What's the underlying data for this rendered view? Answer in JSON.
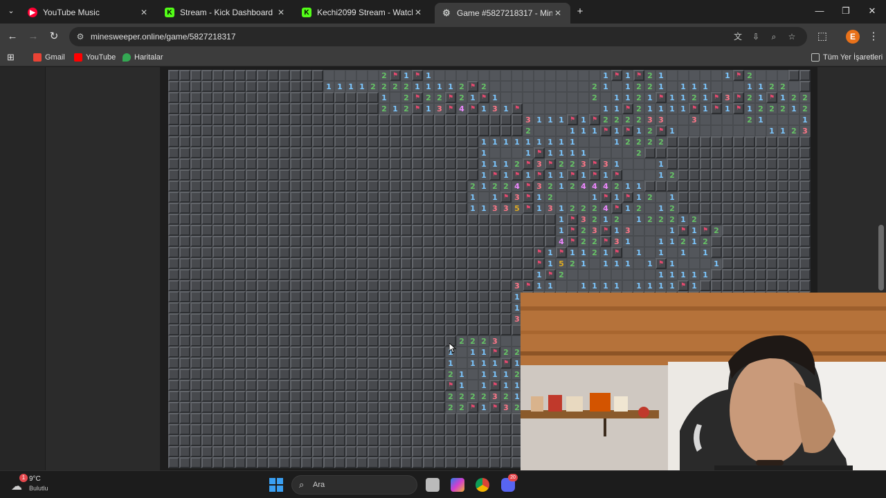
{
  "tabs": [
    {
      "title": "YouTube Music",
      "icon": "youtube-music-icon",
      "color": "#ff0033"
    },
    {
      "title": "Stream - Kick Dashboard",
      "icon": "kick-icon",
      "color": "#53fc18"
    },
    {
      "title": "Kechi2099 Stream - Watch Live",
      "icon": "kick-icon",
      "color": "#53fc18"
    },
    {
      "title": "Game #5827218317 - Minesweeper",
      "icon": "settings-icon",
      "color": "#9aa0a6",
      "active": true
    }
  ],
  "omnibox": {
    "url": "minesweeper.online/game/5827218317"
  },
  "bookmarks": {
    "items": [
      {
        "label": "Gmail",
        "icon": "gmail-icon",
        "color": "#ea4335"
      },
      {
        "label": "YouTube",
        "icon": "youtube-icon",
        "color": "#ff0000"
      },
      {
        "label": "Haritalar",
        "icon": "maps-icon",
        "color": "#34a853"
      }
    ],
    "all_bookmarks": "Tüm Yer İşaretleri"
  },
  "profile": {
    "initial": "E",
    "color": "#e8711a"
  },
  "board": {
    "rows": [
      "..............-----2F1F1---------------1F1F21-----1F2---",
      "..............1111222211112F2---------21-1221-111---1122-",
      "...................1-2F22F21F1--------2-1121F1121F3F21F122",
      "...................212F13F4F131F-------11F21111F1F1F122212",
      "................................3111F1F222233--3----21---1",
      "................................2---111F1F12F1--------1123",
      "............................111111111---12222..........",
      "............................1---1F1111----2.........",
      "............................1112F3F223F31---1.........",
      "............................1F1F1F11F1F1F---12........",
      "...........................21224F3212444211........",
      "...........................1-1F3F12---1F1F12-1........",
      "...........................11335F1312224F12-12........",
      "...................................1F3212-122212........",
      "...................................1F23F13---1F1F2........",
      "...................................4F22F31--11212........",
      ".................................F1F1121F-1-1-1-1........",
      ".................................F1521-111-1F1---1........",
      ".................................1F2--------11111........",
      "...............................3F11--1111-1111F1........",
      "...............................1........................",
      "...............................1........................",
      "...............................321.....................",
      "................................-1.....................",
      "..........................2223---1.....................",
      ".........................1-11F221.....................",
      ".........................1-111F11.....................",
      ".........................21-11121.....................",
      ".........................F1-1F111.....................",
      ".........................22223211.....................",
      ".........................22F1F323....................."
    ]
  },
  "taskbar": {
    "weather_temp": "9°C",
    "weather_desc": "Bulutlu",
    "weather_badge": "1",
    "search_placeholder": "Ara",
    "discord_badge": "20"
  }
}
